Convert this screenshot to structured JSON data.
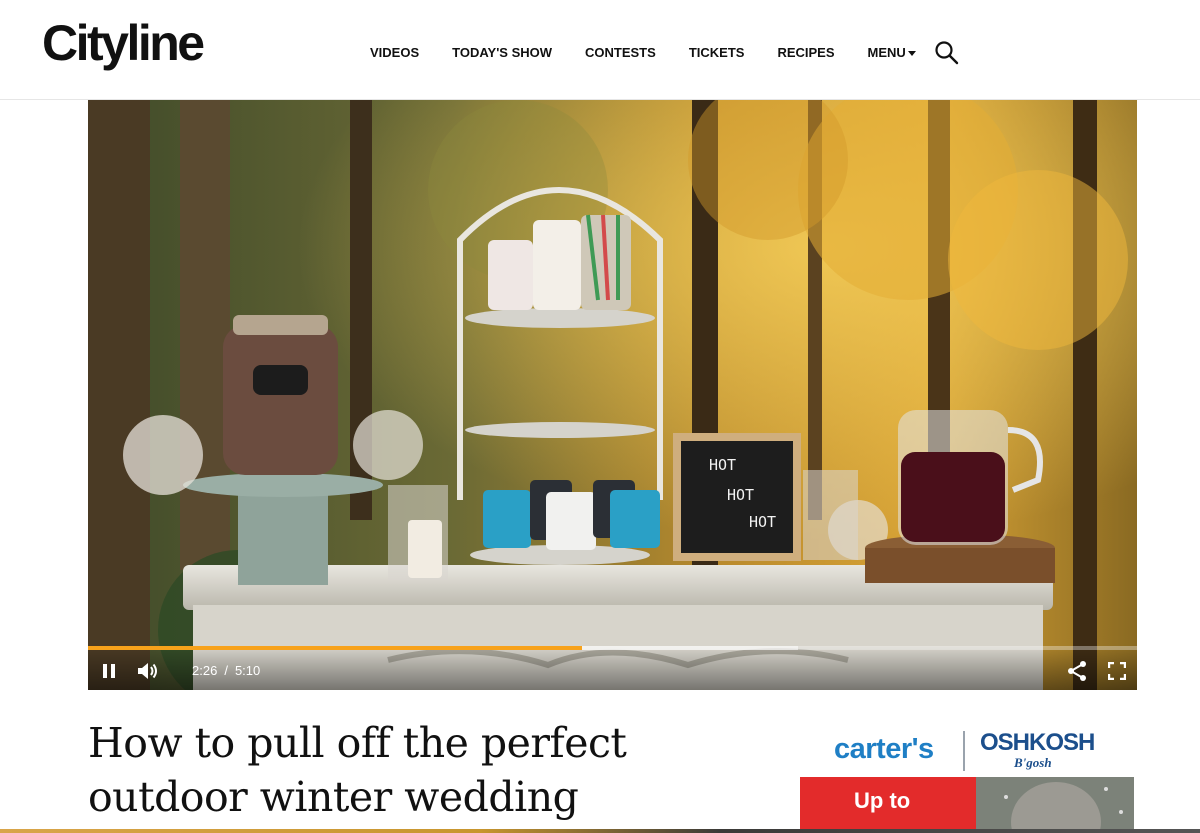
{
  "header": {
    "logo": "Cityline",
    "nav": [
      {
        "label": "VIDEOS"
      },
      {
        "label": "TODAY'S SHOW"
      },
      {
        "label": "CONTESTS"
      },
      {
        "label": "TICKETS"
      },
      {
        "label": "RECIPES"
      },
      {
        "label": "MENU"
      }
    ],
    "search_icon": "search-icon"
  },
  "video": {
    "current_time": "2:26",
    "separator": "/",
    "duration": "5:10",
    "progress_fraction": 0.471,
    "buffered_fraction": 0.677,
    "progress_color": "#f7a21b",
    "letter_board": [
      "HOT",
      "HOT",
      "HOT"
    ],
    "icons": [
      "pause-icon",
      "volume-icon",
      "share-icon",
      "fullscreen-icon"
    ]
  },
  "article": {
    "headline": "How to pull off the perfect outdoor winter wedding"
  },
  "ad": {
    "brand1": "carter's",
    "brand2": "OSHKOSH",
    "brand2_sub": "B'gosh",
    "promo": "Up to",
    "brand1_color": "#1f7fc5",
    "brand2_color": "#1c4f8c",
    "promo_color": "#e32b2b"
  }
}
